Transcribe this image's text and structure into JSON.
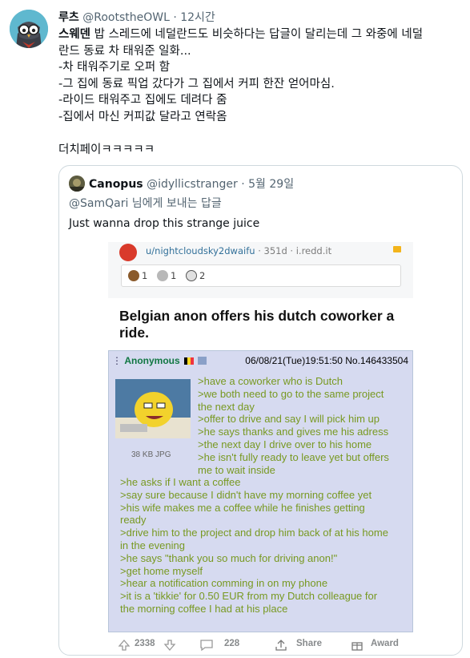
{
  "tweet": {
    "author_name": "루츠",
    "author_handle": "@RootstheOWL",
    "separator": "·",
    "time": "12시간",
    "lines": [
      {
        "bold": "스웨덴",
        "text": " 밥 스레드에 네덜란드도 비슷하다는 답글이 달리는데 그 와중에 네덜"
      },
      {
        "bold": "",
        "text": "란드 동료 차 태워준 일화..."
      },
      {
        "bold": "",
        "text": "-차 태워주기로 오퍼 함"
      },
      {
        "bold": "",
        "text": "-그 집에 동료 픽업 갔다가 그 집에서 커피 한잔 얻어마심."
      },
      {
        "bold": "",
        "text": "-라이드 태워주고 집에도 데려다 줌"
      },
      {
        "bold": "",
        "text": "-집에서 마신 커피값 달라고 연락옴"
      },
      {
        "bold": "",
        "text": ""
      },
      {
        "bold": "",
        "text": "더치페이ㅋㅋㅋㅋㅋ"
      }
    ]
  },
  "quoted": {
    "author_name": "Canopus",
    "author_handle": "@idyllicstranger",
    "separator": "·",
    "date": "5월 29일",
    "reply_text": "@SamQari 님에게 보내는 답글",
    "text": "Just wanna drop this strange juice"
  },
  "reddit": {
    "user": "u/nightcloudsky2dwaifu",
    "meta": " · 351d · i.redd.it",
    "awards": [
      "1",
      "1",
      "2"
    ],
    "title": "Belgian anon offers his dutch coworker a ride.",
    "post": {
      "arrow": "⋮",
      "name": "Anonymous",
      "date_num": "06/08/21(Tue)19:51:50 No.146433504",
      "file_info": "38 KB JPG",
      "lines_right": [
        ">have a coworker who is Dutch",
        ">we both need to go to the same project",
        "the next day",
        ">offer to drive and say I will pick him up",
        ">he says thanks and gives me his adress",
        ">the next day I drive over to his home",
        ">he isn't fully ready to leave yet but offers",
        "me to wait inside"
      ],
      "lines_left": [
        ">he asks if I want a coffee",
        ">say sure because I didn't have my morning coffee yet",
        ">his wife makes me a coffee while he finishes getting",
        "ready",
        ">drive him to the project and drop him back of at his home",
        "in the evening",
        ">he says \"thank you so much for driving anon!\"",
        ">get home myself",
        ">hear a notification comming in on my phone",
        ">it is a 'tikkie' for 0.50 EUR from my Dutch colleague for",
        "the morning coffee I had at his place"
      ]
    },
    "actions": {
      "votes": "2338",
      "comments": "228",
      "share": "Share",
      "award": "Award"
    }
  },
  "colors": {
    "greentext": "#789922",
    "post_bg": "#d6daf0",
    "anon_name": "#117743",
    "muted": "#536471"
  }
}
